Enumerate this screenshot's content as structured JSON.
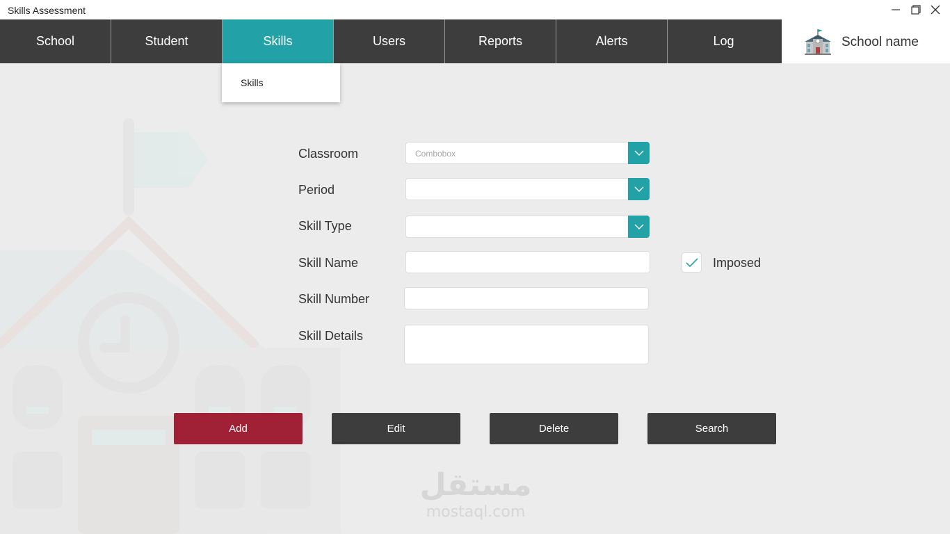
{
  "window": {
    "title": "Skills Assessment"
  },
  "nav": {
    "items": [
      {
        "label": "School"
      },
      {
        "label": "Student"
      },
      {
        "label": "Skills",
        "active": true
      },
      {
        "label": "Users"
      },
      {
        "label": "Reports"
      },
      {
        "label": "Alerts"
      },
      {
        "label": "Log"
      }
    ]
  },
  "brand": {
    "school_name": "School name",
    "icon": "school-building-icon"
  },
  "dropdown": {
    "items": [
      "Skills"
    ]
  },
  "form": {
    "classroom": {
      "label": "Classroom",
      "placeholder": "Combobox",
      "value": ""
    },
    "period": {
      "label": "Period",
      "value": ""
    },
    "skill_type": {
      "label": "Skill Type",
      "value": ""
    },
    "skill_name": {
      "label": "Skill Name",
      "value": ""
    },
    "skill_number": {
      "label": "Skill Number",
      "value": ""
    },
    "skill_details": {
      "label": "Skill Details",
      "value": ""
    },
    "imposed": {
      "label": "Imposed",
      "checked": true
    }
  },
  "actions": {
    "add": "Add",
    "edit": "Edit",
    "delete": "Delete",
    "search": "Search"
  },
  "watermark": {
    "arabic": "مستقل",
    "latin": "mostaql.com"
  },
  "colors": {
    "accent": "#22a2a6",
    "nav_bg": "#3d3d3d",
    "primary_button": "#a02035",
    "page_bg": "#ececec"
  }
}
